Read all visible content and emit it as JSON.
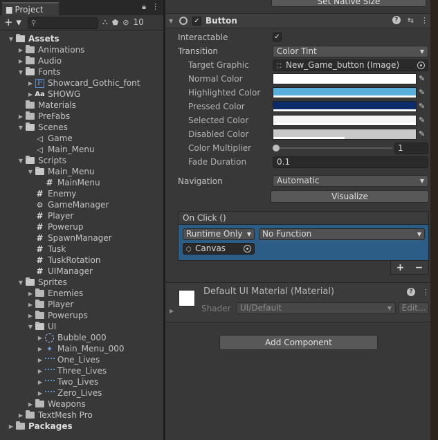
{
  "project": {
    "tab_label": "Project",
    "add_label": "+ ▾",
    "search_placeholder": "",
    "hidden_count": "10",
    "tree": [
      {
        "label": "Assets",
        "depth": 0,
        "type": "folder",
        "open": true,
        "bold": true
      },
      {
        "label": "Animations",
        "depth": 1,
        "type": "folder",
        "open": false,
        "arrow": true
      },
      {
        "label": "Audio",
        "depth": 1,
        "type": "folder",
        "open": false,
        "arrow": true
      },
      {
        "label": "Fonts",
        "depth": 1,
        "type": "folder",
        "open": true,
        "arrow": true
      },
      {
        "label": "Showcard_Gothic_font",
        "depth": 2,
        "type": "font",
        "arrow": true
      },
      {
        "label": "SHOWG",
        "depth": 2,
        "type": "aa",
        "arrow": true
      },
      {
        "label": "Materials",
        "depth": 1,
        "type": "folder",
        "open": false,
        "arrow": false
      },
      {
        "label": "PreFabs",
        "depth": 1,
        "type": "folder",
        "open": false,
        "arrow": true
      },
      {
        "label": "Scenes",
        "depth": 1,
        "type": "folder",
        "open": true,
        "arrow": true
      },
      {
        "label": "Game",
        "depth": 2,
        "type": "scene",
        "arrow": false
      },
      {
        "label": "Main_Menu",
        "depth": 2,
        "type": "scene",
        "arrow": false
      },
      {
        "label": "Scripts",
        "depth": 1,
        "type": "folder",
        "open": true,
        "arrow": true
      },
      {
        "label": "Main_Menu",
        "depth": 2,
        "type": "folder",
        "open": true,
        "arrow": true
      },
      {
        "label": "MainMenu",
        "depth": 3,
        "type": "script",
        "arrow": false
      },
      {
        "label": "Enemy",
        "depth": 2,
        "type": "script",
        "arrow": false
      },
      {
        "label": "GameManager",
        "depth": 2,
        "type": "gear",
        "arrow": false
      },
      {
        "label": "Player",
        "depth": 2,
        "type": "script",
        "arrow": false
      },
      {
        "label": "Powerup",
        "depth": 2,
        "type": "script",
        "arrow": false
      },
      {
        "label": "SpawnManager",
        "depth": 2,
        "type": "script",
        "arrow": false
      },
      {
        "label": "Tusk",
        "depth": 2,
        "type": "script",
        "arrow": false
      },
      {
        "label": "TuskRotation",
        "depth": 2,
        "type": "script",
        "arrow": false
      },
      {
        "label": "UIManager",
        "depth": 2,
        "type": "script",
        "arrow": false
      },
      {
        "label": "Sprites",
        "depth": 1,
        "type": "folder",
        "open": true,
        "arrow": true
      },
      {
        "label": "Enemies",
        "depth": 2,
        "type": "folder",
        "open": false,
        "arrow": true
      },
      {
        "label": "Player",
        "depth": 2,
        "type": "folder",
        "open": false,
        "arrow": true
      },
      {
        "label": "Powerups",
        "depth": 2,
        "type": "folder",
        "open": false,
        "arrow": true
      },
      {
        "label": "UI",
        "depth": 2,
        "type": "folder",
        "open": true,
        "arrow": true
      },
      {
        "label": "Bubble_000",
        "depth": 3,
        "type": "bubble",
        "arrow": true
      },
      {
        "label": "Main_Menu_000",
        "depth": 3,
        "type": "mm",
        "arrow": true
      },
      {
        "label": "One_Lives",
        "depth": 3,
        "type": "sprite",
        "arrow": true
      },
      {
        "label": "Three_Lives",
        "depth": 3,
        "type": "sprite",
        "arrow": true
      },
      {
        "label": "Two_Lives",
        "depth": 3,
        "type": "sprite",
        "arrow": true
      },
      {
        "label": "Zero_Lives",
        "depth": 3,
        "type": "sprite",
        "arrow": true
      },
      {
        "label": "Weapons",
        "depth": 2,
        "type": "folder",
        "open": false,
        "arrow": true
      },
      {
        "label": "TextMesh Pro",
        "depth": 1,
        "type": "folder",
        "open": false,
        "arrow": true
      },
      {
        "label": "Packages",
        "depth": 0,
        "type": "folder",
        "open": false,
        "arrow": true,
        "bold": true
      }
    ]
  },
  "inspector": {
    "native_size_label": "Set Native Size",
    "button_title": "Button",
    "interactable_label": "Interactable",
    "transition_label": "Transition",
    "transition_value": "Color Tint",
    "target_graphic_label": "Target Graphic",
    "target_graphic_value": "New_Game_button (Image)",
    "colors": [
      {
        "label": "Normal Color",
        "hex": "#ffffff",
        "alpha": 1.0
      },
      {
        "label": "Highlighted Color",
        "hex": "#5aaedc",
        "alpha": 1.0
      },
      {
        "label": "Pressed Color",
        "hex": "#0b2b6b",
        "alpha": 1.0
      },
      {
        "label": "Selected Color",
        "hex": "#f5f5f5",
        "alpha": 1.0
      },
      {
        "label": "Disabled Color",
        "hex": "#c8c8c8",
        "alpha": 0.5
      }
    ],
    "color_multiplier_label": "Color Multiplier",
    "color_multiplier_value": "1",
    "fade_duration_label": "Fade Duration",
    "fade_duration_value": "0.1",
    "navigation_label": "Navigation",
    "navigation_value": "Automatic",
    "visualize_label": "Visualize",
    "onclick_title": "On Click ()",
    "runtime_value": "Runtime Only",
    "function_value": "No Function",
    "object_value": "Canvas",
    "plus_label": "+",
    "minus_label": "−",
    "material_title": "Default UI Material (Material)",
    "shader_label": "Shader",
    "shader_value": "UI/Default",
    "edit_label": "Edit...",
    "add_component_label": "Add Component"
  }
}
